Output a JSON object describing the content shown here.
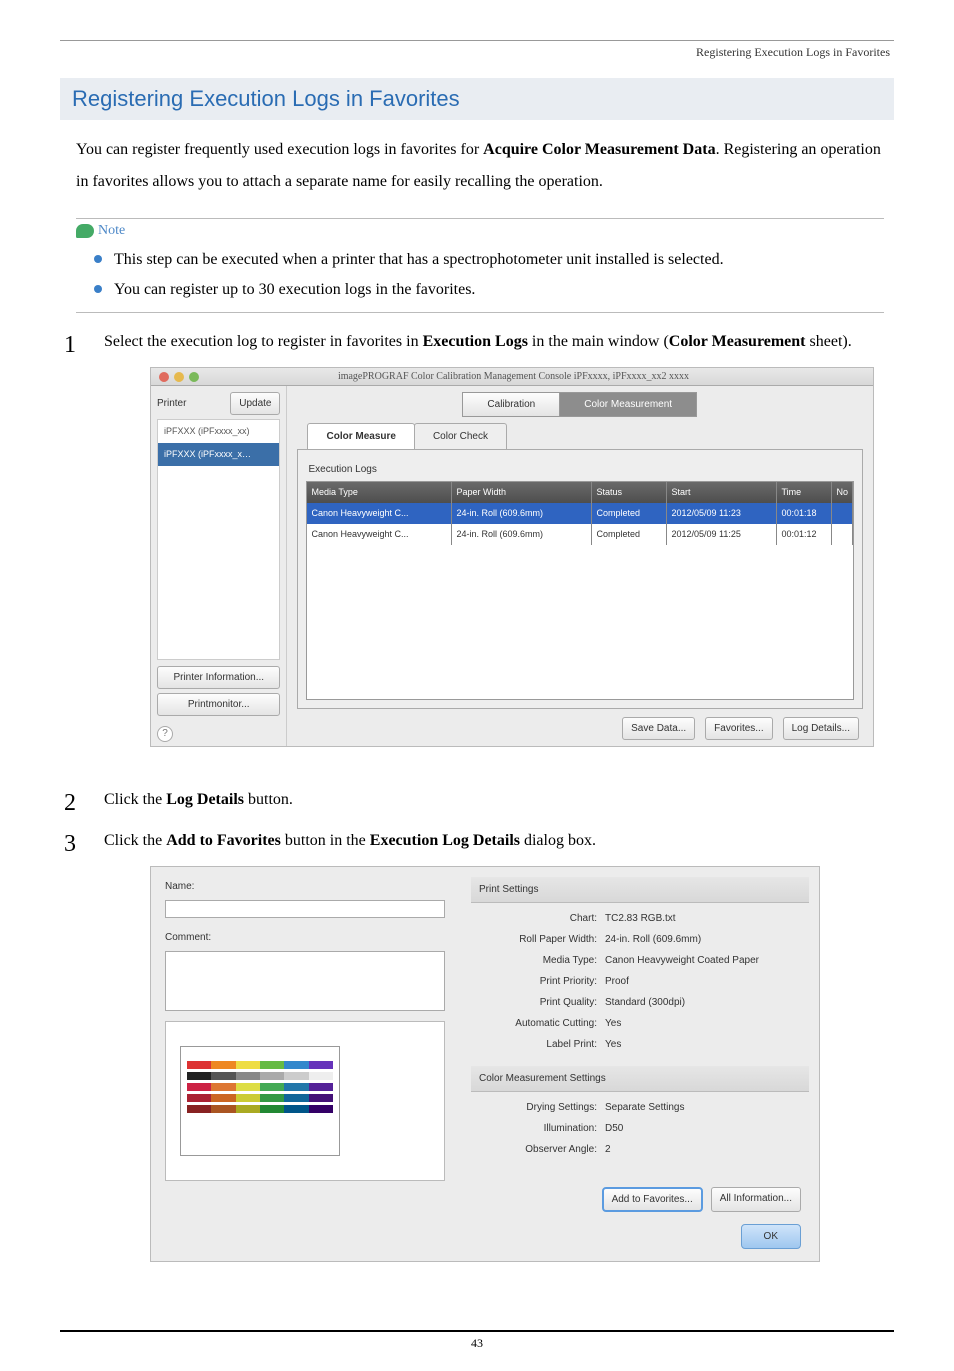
{
  "header": {
    "right": "Registering Execution Logs in Favorites"
  },
  "title": "Registering Execution Logs in Favorites",
  "intro": {
    "pre": "You can register frequently used execution logs in favorites for ",
    "bold": "Acquire Color Measurement Data",
    "post": ". Registering an operation in favorites allows you to attach a separate name for easily recalling the operation."
  },
  "note": {
    "label": "Note",
    "items": [
      "This step can be executed when a printer that has a spectrophotometer unit installed is selected.",
      "You can register up to 30 execution logs in the favorites."
    ]
  },
  "steps": {
    "s1": {
      "num": "1",
      "t1": "Select the execution log to register in favorites in ",
      "b1": "Execution Logs",
      "t2": " in the main window (",
      "b2": "Color Measurement",
      "t3": " sheet)."
    },
    "s2": {
      "num": "2",
      "t1": "Click the ",
      "b1": "Log Details",
      "t2": " button."
    },
    "s3": {
      "num": "3",
      "t1": "Click the ",
      "b1": "Add to Favorites",
      "t2": " button in the ",
      "b2": "Execution Log Details",
      "t3": " dialog box."
    }
  },
  "fig1": {
    "winTitle": "imagePROGRAF Color Calibration Management Console iPFxxxx, iPFxxxx_xx2 xxxx",
    "sidebar": {
      "printerLabel": "Printer",
      "update": "Update",
      "items": [
        "iPFXXX (iPFxxxx_xx)",
        "iPFXXX (iPFxxxx_x…"
      ],
      "info": "Printer Information...",
      "monitor": "Printmonitor..."
    },
    "tabsTop": {
      "calib": "Calibration",
      "cm": "Color Measurement"
    },
    "tabsSub": {
      "measure": "Color Measure",
      "check": "Color Check"
    },
    "execLabel": "Execution Logs",
    "cols": {
      "c1": "Media Type",
      "c2": "Paper Width",
      "c3": "Status",
      "c4": "Start",
      "c5": "Time",
      "c6": "No"
    },
    "rows": [
      {
        "c1": "Canon Heavyweight C...",
        "c2": "24-in. Roll (609.6mm)",
        "c3": "Completed",
        "c4": "2012/05/09 11:23",
        "c5": "00:01:18",
        "c6": ""
      },
      {
        "c1": "Canon Heavyweight C...",
        "c2": "24-in. Roll (609.6mm)",
        "c3": "Completed",
        "c4": "2012/05/09 11:25",
        "c5": "00:01:12",
        "c6": ""
      }
    ],
    "actions": {
      "save": "Save Data...",
      "fav": "Favorites...",
      "log": "Log Details..."
    }
  },
  "fig2": {
    "nameLabel": "Name:",
    "commentLabel": "Comment:",
    "thumbCaption": "",
    "print": {
      "section": "Print Settings",
      "chart": {
        "k": "Chart:",
        "v": "TC2.83 RGB.txt"
      },
      "roll": {
        "k": "Roll Paper Width:",
        "v": "24-in. Roll (609.6mm)"
      },
      "media": {
        "k": "Media Type:",
        "v": "Canon Heavyweight Coated Paper"
      },
      "priority": {
        "k": "Print Priority:",
        "v": "Proof"
      },
      "quality": {
        "k": "Print Quality:",
        "v": "Standard (300dpi)"
      },
      "cut": {
        "k": "Automatic Cutting:",
        "v": "Yes"
      },
      "label": {
        "k": "Label Print:",
        "v": "Yes"
      }
    },
    "cms": {
      "section": "Color Measurement Settings",
      "dry": {
        "k": "Drying Settings:",
        "v": "Separate Settings"
      },
      "ill": {
        "k": "Illumination:",
        "v": "D50"
      },
      "obs": {
        "k": "Observer Angle:",
        "v": "2"
      }
    },
    "actions": {
      "add": "Add to Favorites...",
      "all": "All Information...",
      "ok": "OK"
    }
  },
  "footer": "43"
}
